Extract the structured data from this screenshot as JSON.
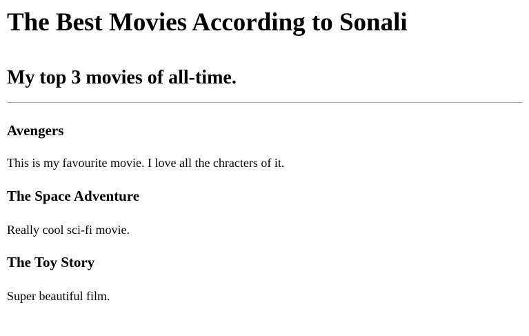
{
  "page": {
    "title": "The Best Movies According to Sonali",
    "subtitle": "My top 3 movies of all-time."
  },
  "movies": [
    {
      "title": "Avengers",
      "description": "This is my favourite movie. I love all the chracters of it."
    },
    {
      "title": "The Space Adventure",
      "description": "Really cool sci-fi movie."
    },
    {
      "title": "The Toy Story",
      "description": "Super beautiful film."
    }
  ]
}
